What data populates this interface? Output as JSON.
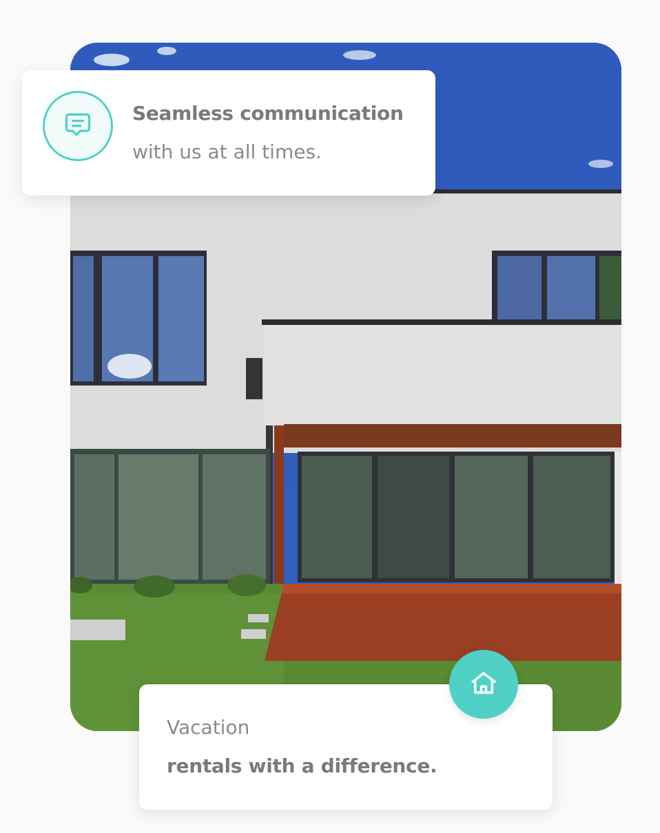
{
  "feature_cards": {
    "communication": {
      "icon": "chat-bubble-icon",
      "title": "Seamless communication",
      "subtitle": "with us at all times."
    },
    "rentals": {
      "icon": "home-icon",
      "title": "Vacation",
      "subtitle": "rentals with a difference."
    }
  },
  "colors": {
    "accent": "#4fd1c5",
    "text_strong": "#7a7a7a",
    "text_light": "#8a8a8a",
    "background": "#fafafa"
  }
}
